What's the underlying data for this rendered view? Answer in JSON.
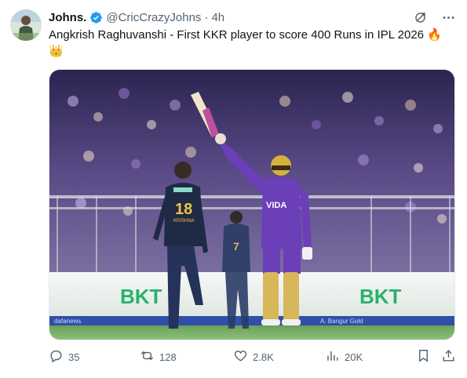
{
  "author": {
    "display_name": "Johns.",
    "handle": "@CricCrazyJohns",
    "time": "4h",
    "separator": "·"
  },
  "tweet": {
    "text": "Angkrish Raghuvanshi - First KKR player to score 400 Runs in IPL 2026 🔥 👑"
  },
  "media": {
    "player_number": "18",
    "player_name": "KRISHNA",
    "jersey_sponsor": "VIDA",
    "board_left": "BKT",
    "board_right": "BKT",
    "strip_text_left": "dafanews",
    "strip_text_right": "A. Bangur Gold"
  },
  "actions": {
    "replies": "35",
    "reposts": "128",
    "likes": "2.8K",
    "views": "20K"
  },
  "colors": {
    "verified": "#1d9bf0",
    "text_secondary": "#536471",
    "kkr_purple": "#4b2a8f",
    "gt_navy": "#1f2a44",
    "bkt_green": "#27b36b"
  },
  "icons": {
    "verified": "verified-badge-icon",
    "grok": "grok-icon",
    "more": "more-icon",
    "reply": "reply-icon",
    "retweet": "retweet-icon",
    "like": "heart-icon",
    "views": "views-icon",
    "bookmark": "bookmark-icon",
    "share": "share-icon"
  }
}
